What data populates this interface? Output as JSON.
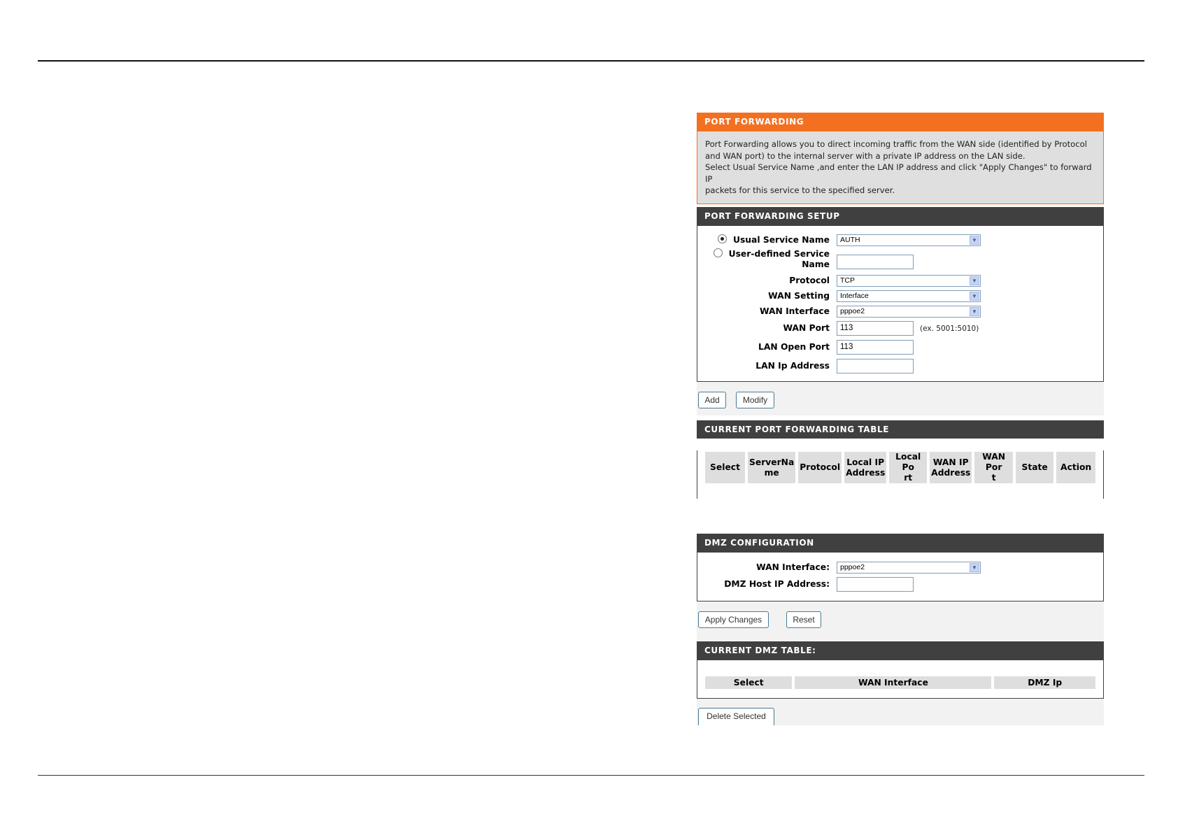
{
  "port_forwarding": {
    "title": "PORT FORWARDING",
    "desc_line1": "Port Forwarding allows you to direct incoming traffic from the WAN side (identified by Protocol",
    "desc_line2": "and WAN port) to the internal server with a private IP address on the LAN side.",
    "desc_line3": "Select Usual Service Name ,and enter the LAN IP address and click \"Apply Changes\" to forward IP",
    "desc_line4": "packets for this service to the specified server."
  },
  "setup": {
    "title": "PORT FORWARDING SETUP",
    "usual_service_label": "Usual Service Name",
    "usual_service_value": "AUTH",
    "user_defined_label_1": "User-defined Service",
    "user_defined_label_2": "Name",
    "user_defined_value": "",
    "protocol_label": "Protocol",
    "protocol_value": "TCP",
    "wan_setting_label": "WAN Setting",
    "wan_setting_value": "Interface",
    "wan_interface_label": "WAN Interface",
    "wan_interface_value": "pppoe2",
    "wan_port_label": "WAN Port",
    "wan_port_value": "113",
    "wan_port_hint": "(ex. 5001:5010)",
    "lan_open_port_label": "LAN Open Port",
    "lan_open_port_value": "113",
    "lan_ip_label": "LAN Ip Address",
    "lan_ip_value": "",
    "add_label": "Add",
    "modify_label": "Modify"
  },
  "current_table": {
    "title": "CURRENT PORT FORWARDING TABLE",
    "columns": [
      [
        "Select"
      ],
      [
        "ServerNa",
        "me"
      ],
      [
        "Protocol"
      ],
      [
        "Local IP",
        "Address"
      ],
      [
        "Local Po",
        "rt"
      ],
      [
        "WAN IP",
        "Address"
      ],
      [
        "WAN Por",
        "t"
      ],
      [
        "State"
      ],
      [
        "Action"
      ]
    ]
  },
  "dmz": {
    "title": "DMZ CONFIGURATION",
    "wan_interface_label": "WAN Interface:",
    "wan_interface_value": "pppoe2",
    "host_ip_label": "DMZ Host IP Address:",
    "host_ip_value": "",
    "apply_label": "Apply Changes",
    "reset_label": "Reset"
  },
  "dmz_table": {
    "title": "CURRENT DMZ TABLE:",
    "col_select": "Select",
    "col_wan": "WAN Interface",
    "col_ip": "DMZ Ip",
    "delete_label": "Delete Selected"
  },
  "colors": {
    "accent_orange": "#f37021",
    "header_dark": "#404040"
  }
}
